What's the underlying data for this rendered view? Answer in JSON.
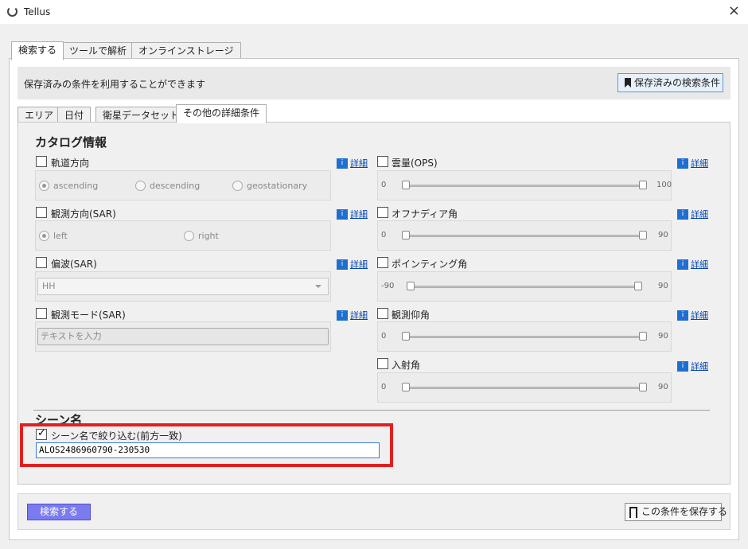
{
  "window": {
    "title": "Tellus",
    "close_glyph": "×"
  },
  "main_tabs": [
    {
      "label": "検索する",
      "active": true
    },
    {
      "label": "ツールで解析",
      "active": false
    },
    {
      "label": "オンラインストレージ",
      "active": false
    }
  ],
  "saved": {
    "text": "保存済みの条件を利用することができます",
    "button_label": "保存済みの検索条件"
  },
  "sub_tabs": [
    {
      "label": "エリア",
      "active": false
    },
    {
      "label": "日付",
      "active": false
    },
    {
      "label": "衛星データセット",
      "active": false
    },
    {
      "label": "その他の詳細条件",
      "active": true
    }
  ],
  "catalog": {
    "title": "カタログ情報",
    "detail_label": "詳細",
    "detail_icon": "i",
    "orbit": {
      "label": "軌道方向",
      "checked": false,
      "options": [
        "ascending",
        "descending",
        "geostationary"
      ],
      "selected": "ascending"
    },
    "look": {
      "label": "観測方向(SAR)",
      "checked": false,
      "options": [
        "left",
        "right"
      ],
      "selected": "left"
    },
    "polarization": {
      "label": "偏波(SAR)",
      "checked": false,
      "value": "HH"
    },
    "mode": {
      "label": "観測モード(SAR)",
      "checked": false,
      "placeholder": "テキストを入力"
    },
    "cloud": {
      "label": "雲量(OPS)",
      "checked": false,
      "min": "0",
      "max": "100"
    },
    "offnadir": {
      "label": "オフナディア角",
      "checked": false,
      "min": "0",
      "max": "90"
    },
    "pointing": {
      "label": "ポインティング角",
      "checked": false,
      "min": "-90",
      "max": "90"
    },
    "elevation": {
      "label": "観測仰角",
      "checked": false,
      "min": "0",
      "max": "90"
    },
    "incidence": {
      "label": "入射角",
      "checked": false,
      "min": "0",
      "max": "90"
    }
  },
  "scene": {
    "title": "シーン名",
    "filter_label": "シーン名で絞り込む(前方一致)",
    "checked": true,
    "value": "ALOS2486960790-230530"
  },
  "footer": {
    "search_label": "検索する",
    "save_label": "この条件を保存する"
  },
  "colors": {
    "highlight": "#e02020",
    "search_button": "#7b7bf0",
    "detail_icon": "#1f6fd1",
    "link": "#0645ad"
  }
}
